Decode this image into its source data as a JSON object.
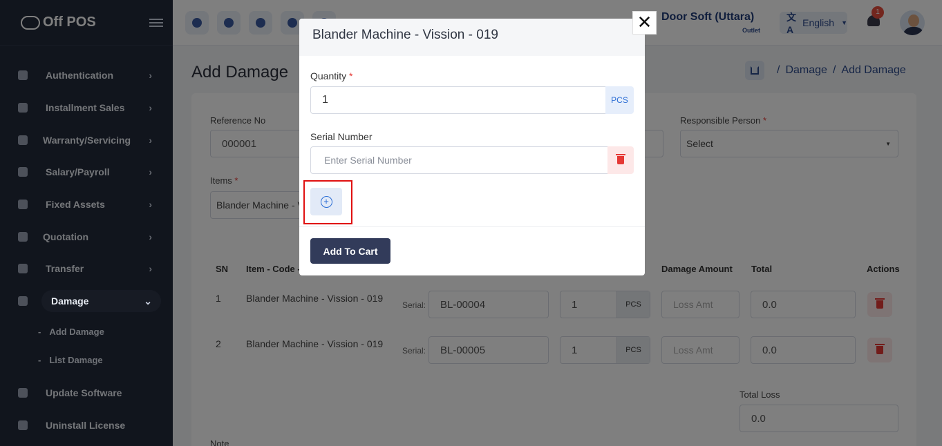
{
  "app": {
    "name": "Off POS"
  },
  "sidebar": {
    "items": [
      {
        "label": "Authentication",
        "icon": "shield-icon"
      },
      {
        "label": "Installment Sales",
        "icon": "graduation-cap-icon"
      },
      {
        "label": "Warranty/Servicing",
        "icon": "bell-icon"
      },
      {
        "label": "Salary/Payroll",
        "icon": "coin-icon"
      },
      {
        "label": "Fixed Assets",
        "icon": "star-icon"
      },
      {
        "label": "Quotation",
        "icon": "quote-icon"
      },
      {
        "label": "Transfer",
        "icon": "send-icon"
      },
      {
        "label": "Damage",
        "icon": "trash-icon",
        "expanded": true
      }
    ],
    "damage_sub": [
      {
        "label": "Add Damage"
      },
      {
        "label": "List Damage"
      }
    ],
    "bottom": [
      {
        "label": "Update Software",
        "icon": "refresh-icon"
      },
      {
        "label": "Uninstall License",
        "icon": "clipboard-icon"
      }
    ]
  },
  "topbar": {
    "outlet_name": "Door Soft (Uttara)",
    "outlet_type": "Outlet",
    "language": "English",
    "notification_count": "1"
  },
  "page": {
    "title": "Add Damage",
    "breadcrumb": [
      "Damage",
      "Add Damage"
    ],
    "reference_label": "Reference No",
    "reference_value": "000001",
    "responsible_label": "Responsible Person",
    "responsible_value": "Select",
    "items_label": "Items",
    "items_value": "Blander Machine - V",
    "table": {
      "headers": [
        "SN",
        "Item - Code -",
        "Damage Amount",
        "Total",
        "Actions"
      ],
      "rows": [
        {
          "sn": "1",
          "item": "Blander Machine - Vission - 019",
          "serial_label": "Serial:",
          "serial": "BL-00004",
          "qty": "1",
          "unit": "PCS",
          "loss_placeholder": "Loss Amt",
          "total": "0.0"
        },
        {
          "sn": "2",
          "item": "Blander Machine - Vission - 019",
          "serial_label": "Serial:",
          "serial": "BL-00005",
          "qty": "1",
          "unit": "PCS",
          "loss_placeholder": "Loss Amt",
          "total": "0.0"
        }
      ]
    },
    "total_loss_label": "Total Loss",
    "total_loss_value": "0.0",
    "note_label": "Note"
  },
  "modal": {
    "title": "Blander Machine - Vission - 019",
    "quantity_label": "Quantity",
    "quantity_value": "1",
    "unit": "PCS",
    "serial_label": "Serial Number",
    "serial_placeholder": "Enter Serial Number",
    "add_to_cart": "Add To Cart",
    "close_symbol": "✕"
  },
  "colors": {
    "sidebar": "#232a3b",
    "accent": "#2c4a8c",
    "danger": "#e53935",
    "button": "#323b5a"
  }
}
